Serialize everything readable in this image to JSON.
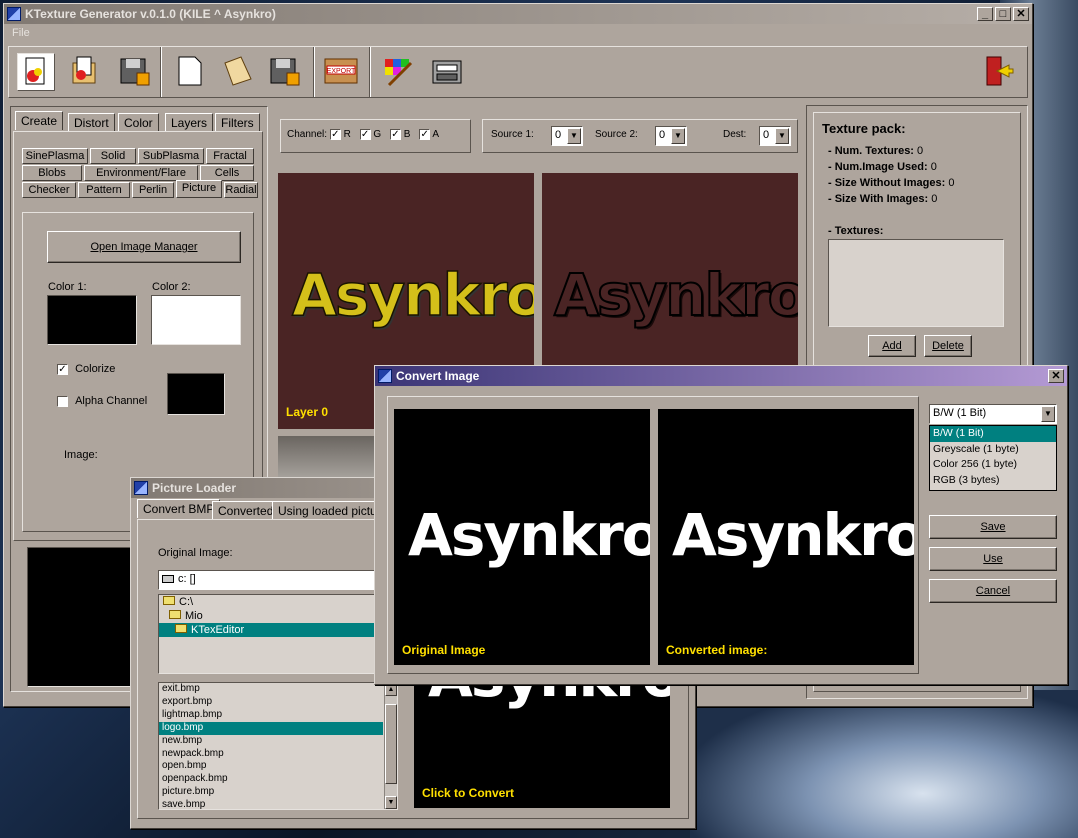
{
  "main_window": {
    "title": "KTexture Generator v.0.1.0 (KILE ^ Asynkro)",
    "menu": [
      "File"
    ],
    "main_tabs": [
      "Create",
      "Distort",
      "Color",
      "Layers",
      "Filters"
    ],
    "sub_tabs_row1": [
      "SinePlasma",
      "Solid",
      "SubPlasma",
      "Fractal"
    ],
    "sub_tabs_row2": [
      "Blobs",
      "Environment/Flare",
      "Cells"
    ],
    "sub_tabs_row3": [
      "Checker",
      "Pattern",
      "Perlin",
      "Picture",
      "Radial"
    ],
    "open_image_manager": "Open Image Manager",
    "color1_label": "Color 1:",
    "color2_label": "Color 2:",
    "colorize_label": "Colorize",
    "alpha_channel_label": "Alpha Channel",
    "image_label": "Image:",
    "channel_label": "Channel:",
    "channels": [
      "R",
      "G",
      "B",
      "A"
    ],
    "source1_label": "Source 1:",
    "source1_value": "0",
    "source2_label": "Source 2:",
    "source2_value": "0",
    "dest_label": "Dest:",
    "dest_value": "0",
    "preview_text": "Asynkro",
    "layer_label": "Layer 0",
    "colors": {
      "color1": "#000000",
      "color2": "#ffffff",
      "alpha": "#000000",
      "preview_bg": "#4a2424"
    }
  },
  "texture_pack": {
    "title": "Texture pack:",
    "num_textures_label": "- Num. Textures:",
    "num_textures": "0",
    "num_image_used_label": "- Num.Image Used:",
    "num_image_used": "0",
    "size_without_label": "- Size Without Images:",
    "size_without": "0",
    "size_with_label": "- Size With Images:",
    "size_with": "0",
    "textures_label": "- Textures:",
    "add_button": "Add",
    "delete_button": "Delete"
  },
  "picture_loader": {
    "title": "Picture Loader",
    "tabs": [
      "Convert BMP",
      "Converted",
      "Using loaded picture"
    ],
    "original_image_label": "Original Image:",
    "drive": "c: []",
    "folders": [
      "C:\\",
      "Mio",
      "KTexEditor"
    ],
    "files": [
      "exit.bmp",
      "export.bmp",
      "lightmap.bmp",
      "logo.bmp",
      "new.bmp",
      "newpack.bmp",
      "open.bmp",
      "openpack.bmp",
      "picture.bmp",
      "save.bmp"
    ],
    "selected_file": "logo.bmp",
    "click_to_convert": "Click to Convert"
  },
  "convert_image": {
    "title": "Convert Image",
    "original_label": "Original Image",
    "converted_label": "Converted image:",
    "mode_selected": "B/W (1 Bit)",
    "mode_options": [
      "B/W (1 Bit)",
      "Greyscale (1 byte)",
      "Color 256 (1 byte)",
      "RGB (3 bytes)"
    ],
    "save_button": "Save",
    "use_button": "Use",
    "cancel_button": "Cancel"
  }
}
